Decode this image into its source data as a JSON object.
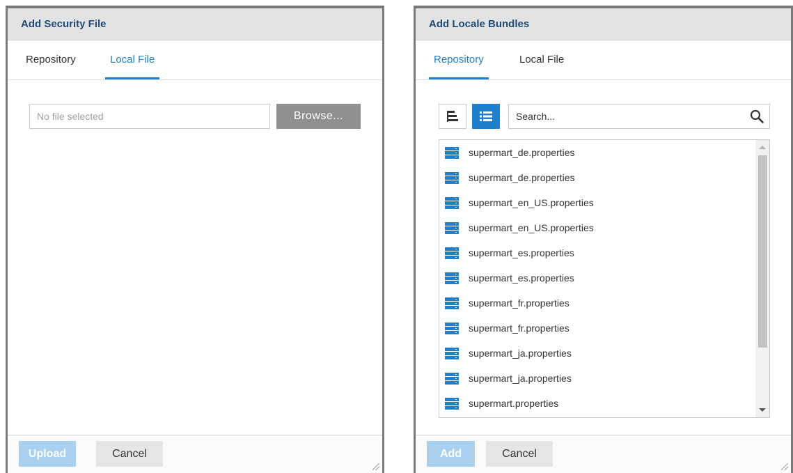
{
  "left_dialog": {
    "title": "Add Security File",
    "tabs": [
      {
        "label": "Repository",
        "active": false
      },
      {
        "label": "Local File",
        "active": true
      }
    ],
    "file_input": {
      "placeholder": "No file selected",
      "value": ""
    },
    "browse_label": "Browse...",
    "footer": {
      "primary_label": "Upload",
      "secondary_label": "Cancel"
    }
  },
  "right_dialog": {
    "title": "Add Locale Bundles",
    "tabs": [
      {
        "label": "Repository",
        "active": true
      },
      {
        "label": "Local File",
        "active": false
      }
    ],
    "view_toggle": {
      "tree_icon": "tree-view-icon",
      "list_icon": "list-view-icon",
      "selected": "list"
    },
    "search": {
      "placeholder": "Search...",
      "icon": "search-icon"
    },
    "files": [
      {
        "name": "supermart_de.properties",
        "icon": "file-icon"
      },
      {
        "name": "supermart_de.properties",
        "icon": "file-icon"
      },
      {
        "name": "supermart_en_US.properties",
        "icon": "file-icon"
      },
      {
        "name": "supermart_en_US.properties",
        "icon": "file-icon"
      },
      {
        "name": "supermart_es.properties",
        "icon": "file-icon"
      },
      {
        "name": "supermart_es.properties",
        "icon": "file-icon"
      },
      {
        "name": "supermart_fr.properties",
        "icon": "file-icon"
      },
      {
        "name": "supermart_fr.properties",
        "icon": "file-icon"
      },
      {
        "name": "supermart_ja.properties",
        "icon": "file-icon"
      },
      {
        "name": "supermart_ja.properties",
        "icon": "file-icon"
      },
      {
        "name": "supermart.properties",
        "icon": "file-icon"
      }
    ],
    "footer": {
      "primary_label": "Add",
      "secondary_label": "Cancel"
    }
  },
  "colors": {
    "accent": "#1f7fcf",
    "title_text": "#1e4a75",
    "header_bg": "#e3e3e3",
    "primary_disabled": "#a9d0ee",
    "browse_bg": "#8f8f8f"
  }
}
